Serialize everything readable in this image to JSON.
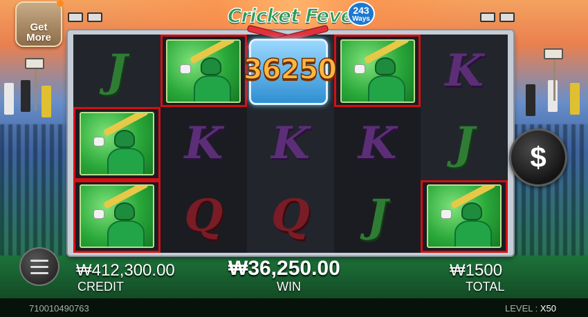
{
  "game": {
    "title": "Cricket Fever",
    "ways_number": "243",
    "ways_label": "Ways",
    "get_more_label": "Get More"
  },
  "reels": {
    "columns": [
      [
        "J",
        "PLAYER",
        "PLAYER"
      ],
      [
        "PLAYER",
        "K",
        "Q"
      ],
      [
        "WILD",
        "K",
        "Q"
      ],
      [
        "PLAYER",
        "K",
        "J"
      ],
      [
        "K",
        "J",
        "PLAYER"
      ]
    ],
    "winning_cells": [
      [
        0,
        1
      ],
      [
        0,
        2
      ],
      [
        1,
        0
      ],
      [
        3,
        0
      ],
      [
        4,
        2
      ]
    ]
  },
  "win_amount_display": "36250",
  "balance": {
    "credit_value": "₩412,300.00",
    "credit_label": "CREDIT",
    "win_value": "₩36,250.00",
    "win_label": "WIN",
    "bet_value": "₩1500",
    "bet_label": "TOTAL"
  },
  "footer": {
    "round_id": "710010490763",
    "level_label": "LEVEL : ",
    "level_value": "X50"
  },
  "icons": {
    "spin": "dollar-icon",
    "menu": "hamburger-icon"
  },
  "colors": {
    "win_outline": "#d50f12",
    "win_number": "#ffb640"
  }
}
